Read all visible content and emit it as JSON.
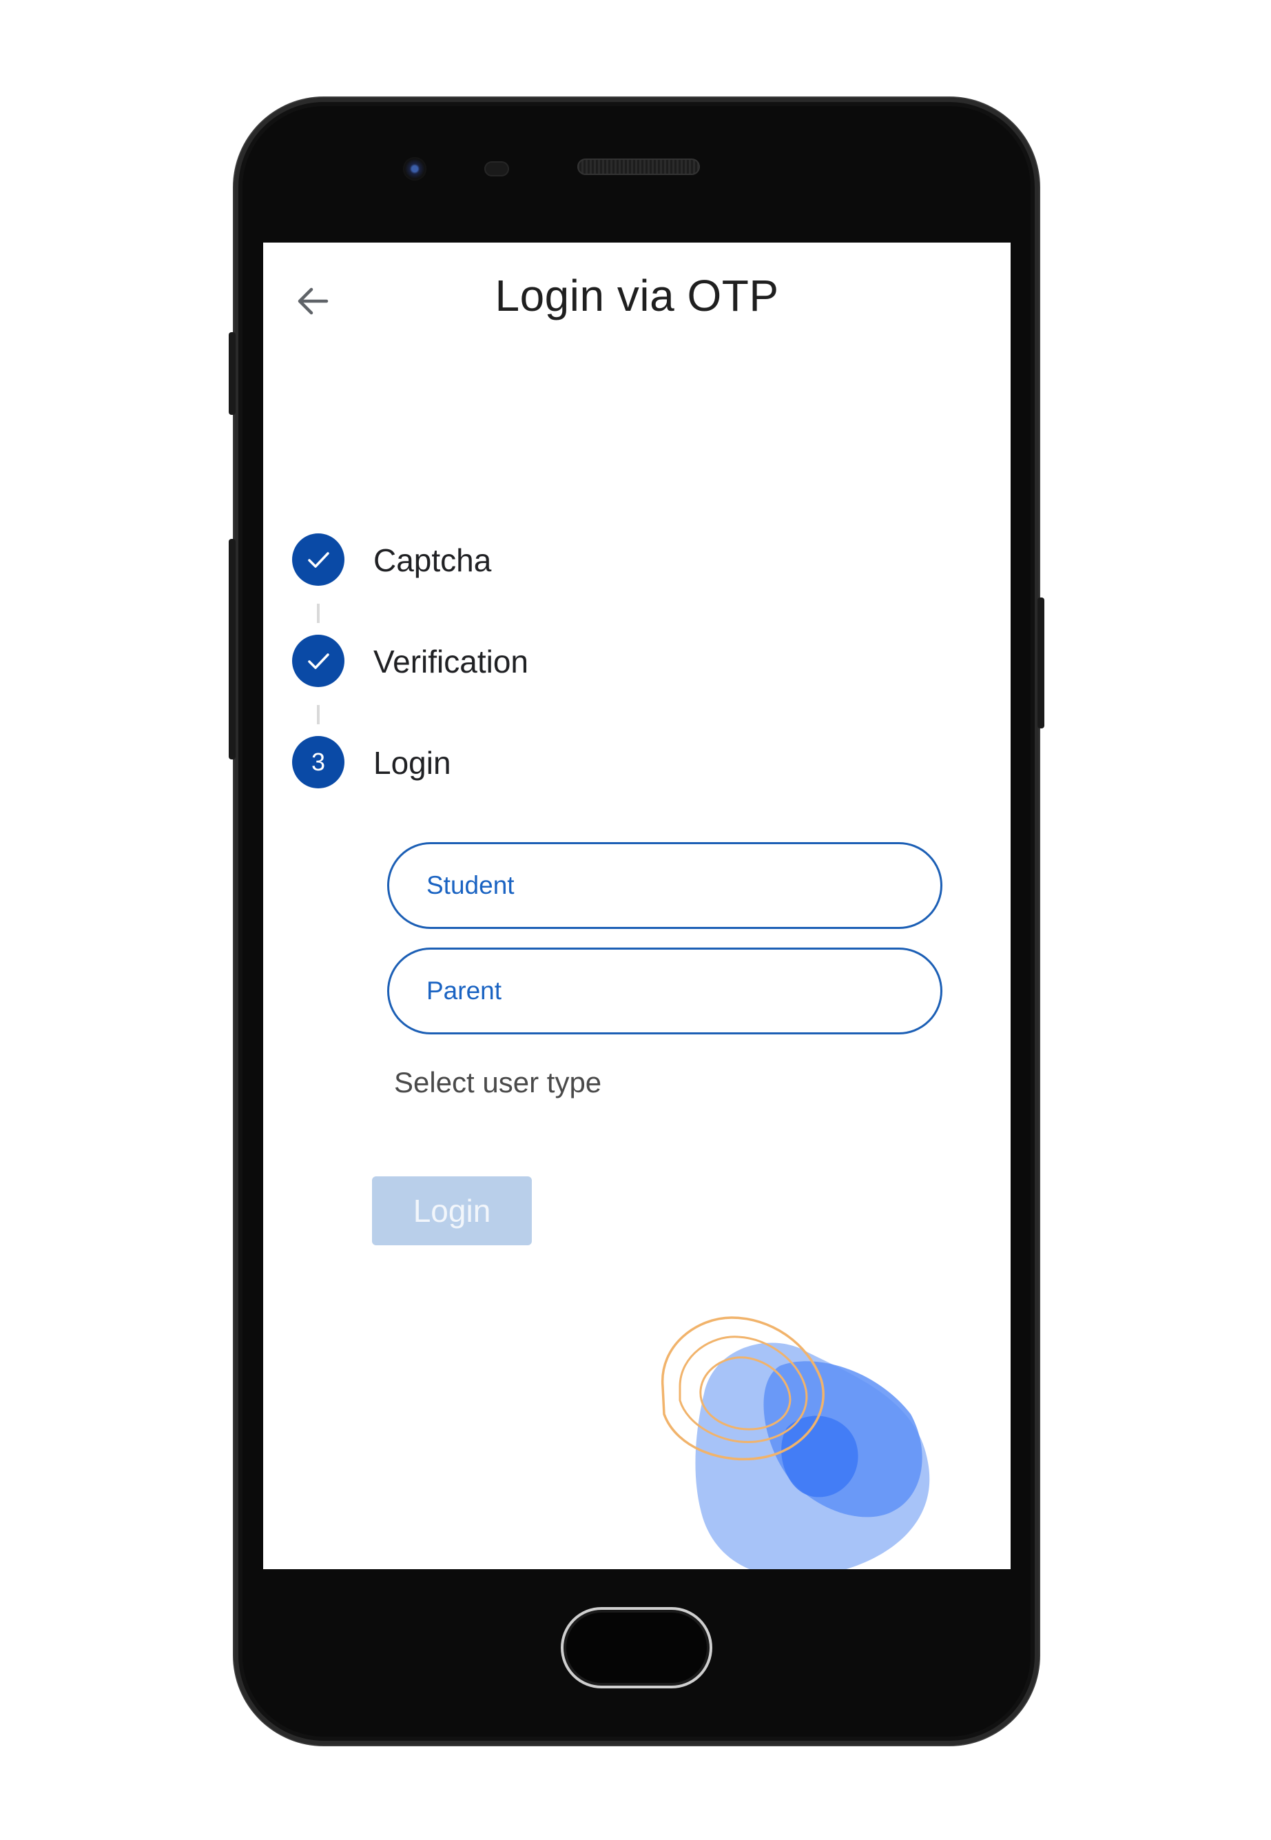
{
  "header": {
    "title": "Login via OTP",
    "back_icon": "arrow-left-icon"
  },
  "stepper": {
    "steps": [
      {
        "label": "Captcha",
        "status": "completed",
        "icon": "check-icon"
      },
      {
        "label": "Verification",
        "status": "completed",
        "icon": "check-icon"
      },
      {
        "label": "Login",
        "status": "active",
        "number": "3"
      }
    ]
  },
  "user_type": {
    "options": [
      {
        "label": "Student"
      },
      {
        "label": "Parent"
      }
    ],
    "hint": "Select user type"
  },
  "login_button": {
    "label": "Login",
    "state": "disabled"
  },
  "colors": {
    "primary": "#0a4aa6",
    "option_border": "#1c5fb5",
    "option_text": "#1a63c2",
    "disabled_button": "#b9cfea",
    "decoration_blue": "#4f86f7",
    "decoration_orange": "#f1b36b"
  }
}
